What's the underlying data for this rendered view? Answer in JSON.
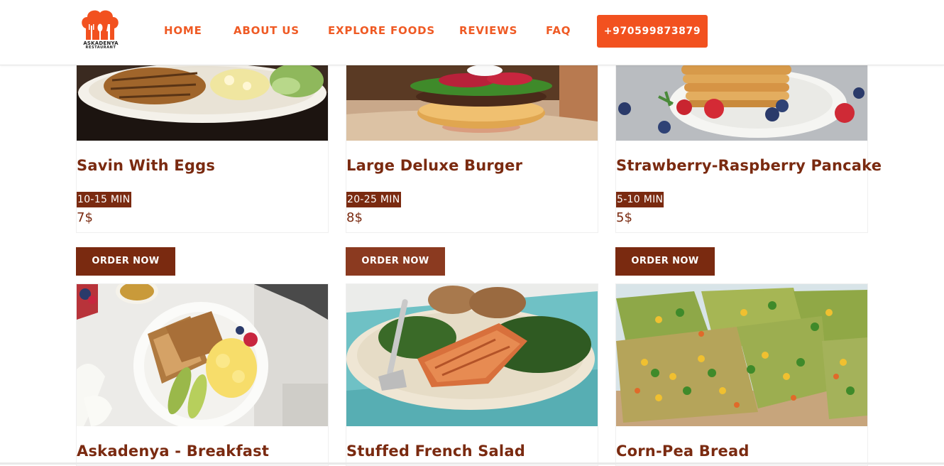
{
  "brand": {
    "name": "ASKADENYA",
    "sub": "RESTAURANT",
    "accent": "#f2511f",
    "dark": "#7a2a10"
  },
  "nav": {
    "items": [
      "HOME",
      "ABOUT US",
      "EXPLORE FOODS",
      "REVIEWS",
      "FAQ"
    ],
    "phone": "+970599873879"
  },
  "cards_top": [
    {
      "title": "Savin With Eggs",
      "time": "10-15 MIN",
      "price": "7$",
      "order": "ORDER NOW"
    },
    {
      "title": "Large Deluxe Burger",
      "time": "20-25 MIN",
      "price": "8$",
      "order": "ORDER NOW"
    },
    {
      "title": "Strawberry-Raspberry Pancake",
      "time": "5-10 MIN",
      "price": "5$",
      "order": "ORDER NOW"
    }
  ],
  "cards_bottom": [
    {
      "title": "Askadenya - Breakfast"
    },
    {
      "title": "Stuffed French Salad"
    },
    {
      "title": "Corn-Pea Bread"
    }
  ],
  "icons": {
    "logo": "chef-hat-cutlery-icon"
  }
}
